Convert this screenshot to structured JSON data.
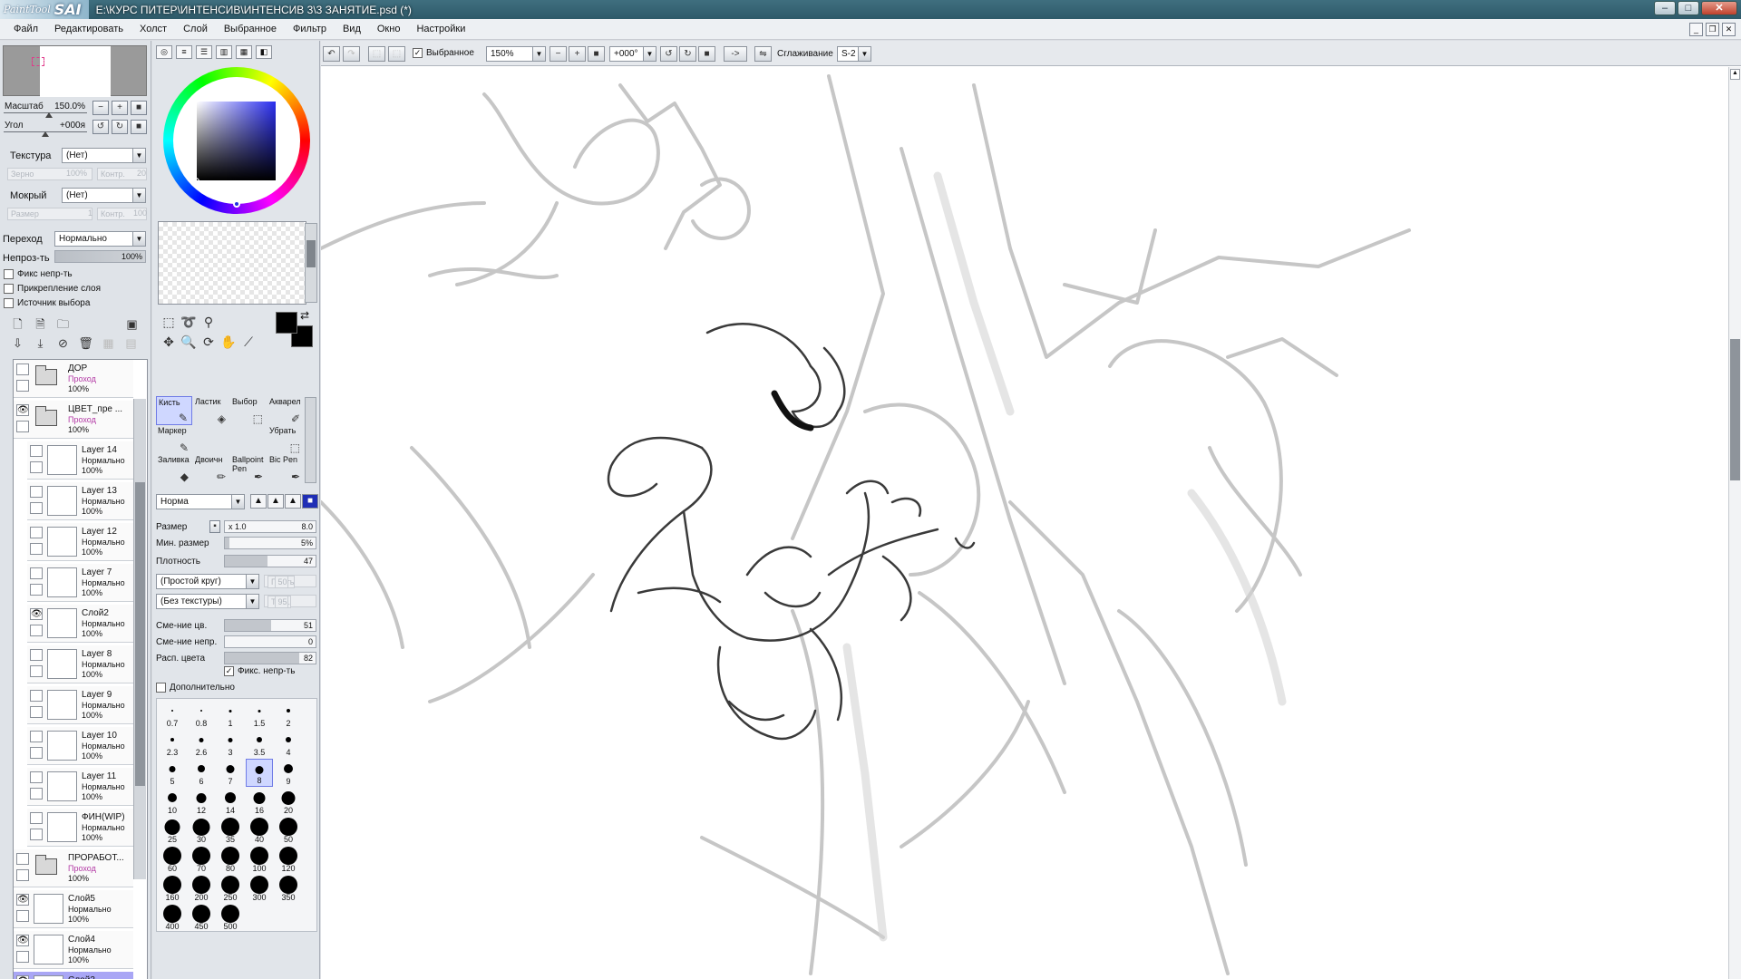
{
  "titlebar": {
    "logo_painttool": "PaintTool",
    "logo_sai": "SAI",
    "title": "E:\\КУРС ПИТЕР\\ИНТЕНСИВ\\ИНТЕНСИВ 3\\3 ЗАНЯТИЕ.psd (*)"
  },
  "menu": [
    "Файл",
    "Редактировать",
    "Холст",
    "Слой",
    "Выбранное",
    "Фильтр",
    "Вид",
    "Окно",
    "Настройки"
  ],
  "navigator": {
    "zoom_label": "Масштаб",
    "zoom_value": "150.0%",
    "angle_label": "Угол",
    "angle_value": "+000я"
  },
  "layer_props": {
    "texture_label": "Текстура",
    "texture_value": "(Нет)",
    "grain_label": "Зерно",
    "grain_value": "100%",
    "contrast_label": "Контр.",
    "contrast_value": "20",
    "wet_label": "Мокрый",
    "wet_value": "(Нет)",
    "size_label": "Размер",
    "size_value": "1",
    "contrast2_label": "Контр.",
    "contrast2_value": "100",
    "blend_label": "Переход",
    "blend_value": "Нормально",
    "opacity_label": "Непроз-ть",
    "opacity_value": "100%",
    "check_fix_opacity": "Фикс непр-ть",
    "check_clip": "Прикрепление слоя",
    "check_selection_source": "Источник выбора"
  },
  "layers": [
    {
      "name": "ДОР",
      "mode": "Проход",
      "opacity": "100%",
      "type": "folder",
      "indent": false,
      "visible": false,
      "selected": false
    },
    {
      "name": "ЦВЕТ_пре ...",
      "mode": "Проход",
      "opacity": "100%",
      "type": "folder",
      "indent": false,
      "visible": true,
      "selected": false
    },
    {
      "name": "Layer 14",
      "mode": "Нормально",
      "opacity": "100%",
      "type": "layer",
      "indent": true,
      "visible": false,
      "selected": false
    },
    {
      "name": "Layer 13",
      "mode": "Нормально",
      "opacity": "100%",
      "type": "layer",
      "indent": true,
      "visible": false,
      "selected": false
    },
    {
      "name": "Layer 12",
      "mode": "Нормально",
      "opacity": "100%",
      "type": "layer",
      "indent": true,
      "visible": false,
      "selected": false
    },
    {
      "name": "Layer 7",
      "mode": "Нормально",
      "opacity": "100%",
      "type": "layer",
      "indent": true,
      "visible": false,
      "selected": false
    },
    {
      "name": "Слой2",
      "mode": "Нормально",
      "opacity": "100%",
      "type": "layer",
      "indent": true,
      "visible": true,
      "selected": false
    },
    {
      "name": "Layer 8",
      "mode": "Нормально",
      "opacity": "100%",
      "type": "layer",
      "indent": true,
      "visible": false,
      "selected": false
    },
    {
      "name": "Layer 9",
      "mode": "Нормально",
      "opacity": "100%",
      "type": "layer",
      "indent": true,
      "visible": false,
      "selected": false
    },
    {
      "name": "Layer 10",
      "mode": "Нормально",
      "opacity": "100%",
      "type": "layer",
      "indent": true,
      "visible": false,
      "selected": false
    },
    {
      "name": "Layer 11",
      "mode": "Нормально",
      "opacity": "100%",
      "type": "layer",
      "indent": true,
      "visible": false,
      "selected": false
    },
    {
      "name": "ФИН(WIP)",
      "mode": "Нормально",
      "opacity": "100%",
      "type": "layer",
      "indent": true,
      "visible": false,
      "selected": false
    },
    {
      "name": "ПРОРАБОТ...",
      "mode": "Проход",
      "opacity": "100%",
      "type": "folder",
      "indent": false,
      "visible": false,
      "selected": false
    },
    {
      "name": "Слой5",
      "mode": "Нормально",
      "opacity": "100%",
      "type": "layer",
      "indent": false,
      "visible": true,
      "selected": false
    },
    {
      "name": "Слой4",
      "mode": "Нормально",
      "opacity": "100%",
      "type": "layer",
      "indent": false,
      "visible": true,
      "selected": false
    },
    {
      "name": "Слой3",
      "mode": "Нормально",
      "opacity": "100%",
      "type": "layer",
      "indent": false,
      "visible": true,
      "selected": true
    }
  ],
  "brushes": [
    {
      "name": "Кисть",
      "icon": "✎",
      "active": true
    },
    {
      "name": "Ластик",
      "icon": "◈",
      "active": false
    },
    {
      "name": "Выбор",
      "icon": "⬚",
      "active": false
    },
    {
      "name": "Акварел",
      "icon": "✐",
      "active": false
    },
    {
      "name": "Маркер",
      "icon": "✎",
      "active": false
    },
    {
      "name": "",
      "icon": "",
      "active": false
    },
    {
      "name": "",
      "icon": "",
      "active": false
    },
    {
      "name": "Убрать",
      "icon": "⬚",
      "active": false
    },
    {
      "name": "Заливка",
      "icon": "◆",
      "active": false
    },
    {
      "name": "Двоичн",
      "icon": "✏",
      "active": false
    },
    {
      "name": "Ballpoint Pen",
      "icon": "✒",
      "active": false
    },
    {
      "name": "Bic Pen",
      "icon": "✒",
      "active": false
    }
  ],
  "brush_settings": {
    "mode_value": "Норма",
    "size_label": "Размер",
    "size_mult": "x 1.0",
    "size_value": "8.0",
    "size_fill": 0.0,
    "min_size_label": "Мин. размер",
    "min_size_value": "5%",
    "min_size_fill": 0.05,
    "density_label": "Плотность",
    "density_value": "47",
    "density_fill": 0.47,
    "shape_value": "(Простой круг)",
    "shape_strength_label": "Плоть",
    "shape_strength_value": "50",
    "texture_value": "(Без текстуры)",
    "texture_strength_label": "Текс.",
    "texture_strength_value": "95",
    "blend_label": "Сме-ние цв.",
    "blend_value": "51",
    "blend_fill": 0.51,
    "dilution_label": "Сме-ние непр.",
    "dilution_value": "0",
    "dilution_fill": 0.0,
    "persistence_label": "Расп. цвета",
    "persistence_value": "82",
    "persistence_fill": 0.82,
    "keep_opacity_label": "Фикс. непр-ть",
    "advanced_label": "Дополнительно"
  },
  "brush_sizes": [
    "0.7",
    "0.8",
    "1",
    "1.5",
    "2",
    "2.3",
    "2.6",
    "3",
    "3.5",
    "4",
    "5",
    "6",
    "7",
    "8",
    "9",
    "10",
    "12",
    "14",
    "16",
    "20",
    "25",
    "30",
    "35",
    "40",
    "50",
    "60",
    "70",
    "80",
    "100",
    "120",
    "160",
    "200",
    "250",
    "300",
    "350",
    "400",
    "450",
    "500"
  ],
  "brush_size_selected": "8",
  "canvas_toolbar": {
    "selected_label": "Выбранное",
    "zoom_value": "150%",
    "angle_value": "+000°",
    "flip_label": "->",
    "stabilizer_label": "Сглаживание",
    "stabilizer_value": "S-2"
  },
  "colors": {
    "primary": "#000000",
    "secondary": "#000000",
    "selected_layer": "#a9a6f5",
    "titlebar": "#2e5a69"
  }
}
